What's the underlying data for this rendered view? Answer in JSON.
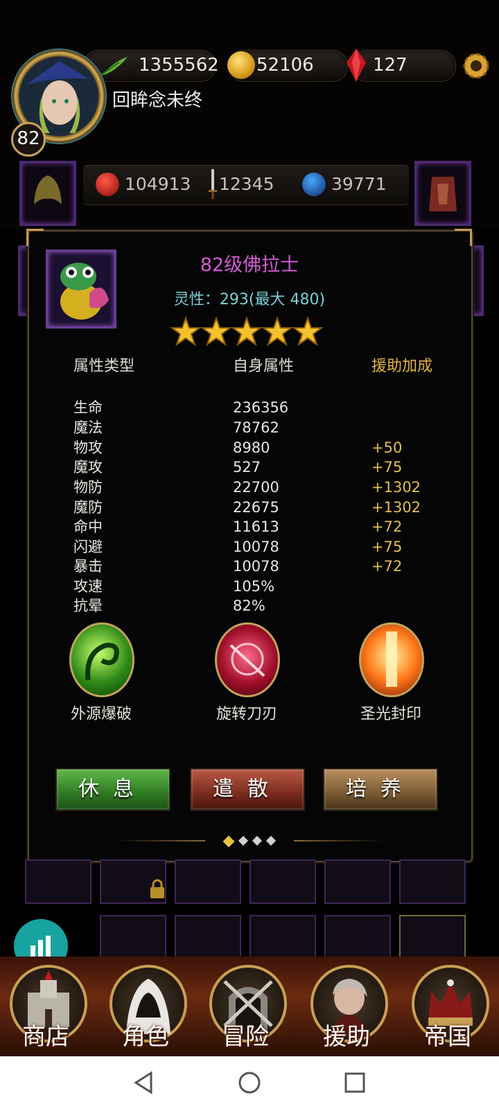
{
  "resources": {
    "power": "1355562",
    "gold": "52106",
    "gems": "127"
  },
  "player": {
    "level": "82",
    "name": "回眸念未终"
  },
  "top_stats": {
    "hp": "104913",
    "attack": "12345",
    "mana": "39771"
  },
  "panel": {
    "title": "82级佛拉士",
    "spirit": "灵性：293(最大 480)",
    "stars": 5,
    "headers": {
      "type": "属性类型",
      "self": "自身属性",
      "support": "援助加成"
    },
    "rows": [
      {
        "label": "生命",
        "self": "236356",
        "bonus": ""
      },
      {
        "label": "魔法",
        "self": "78762",
        "bonus": ""
      },
      {
        "label": "物攻",
        "self": "8980",
        "bonus": "+50"
      },
      {
        "label": "魔攻",
        "self": "527",
        "bonus": "+75"
      },
      {
        "label": "物防",
        "self": "22700",
        "bonus": "+1302"
      },
      {
        "label": "魔防",
        "self": "22675",
        "bonus": "+1302"
      },
      {
        "label": "命中",
        "self": "11613",
        "bonus": "+72"
      },
      {
        "label": "闪避",
        "self": "10078",
        "bonus": "+75"
      },
      {
        "label": "暴击",
        "self": "10078",
        "bonus": "+72"
      },
      {
        "label": "攻速",
        "self": "105%",
        "bonus": ""
      },
      {
        "label": "抗晕",
        "self": "82%",
        "bonus": ""
      }
    ],
    "skills": [
      {
        "name": "外源爆破",
        "icon": "green-serpent-skill-icon"
      },
      {
        "name": "旋转刀刃",
        "icon": "spinning-blade-skill-icon"
      },
      {
        "name": "圣光封印",
        "icon": "holy-seal-skill-icon"
      }
    ],
    "buttons": {
      "rest": "休息",
      "dismiss": "遣散",
      "train": "培养"
    },
    "page_indicator": {
      "total": 4,
      "current": 1
    }
  },
  "nav": {
    "shop": "商店",
    "character": "角色",
    "adventure": "冒险",
    "support": "援助",
    "empire": "帝国"
  },
  "colors": {
    "title": "#d25cd4",
    "spirit": "#7ad0d8",
    "bonus": "#e2c050",
    "rest_btn": "#3e8a2c",
    "dismiss_btn": "#8a3424",
    "train_btn": "#8a6a3a"
  }
}
